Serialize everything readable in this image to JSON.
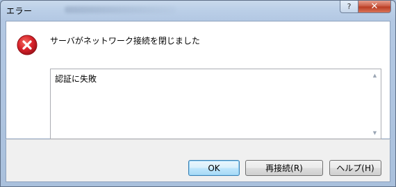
{
  "window": {
    "title": "エラー"
  },
  "titlebar": {
    "help_label": "?",
    "close_label": "✕"
  },
  "dialog": {
    "message": "サーバがネットワーク接続を閉じました",
    "detail": "認証に失敗",
    "icon": "error-icon",
    "error_color": "#d8222a"
  },
  "buttons": {
    "ok": "OK",
    "reconnect": "再接続(R)",
    "help": "ヘルプ(H)"
  }
}
